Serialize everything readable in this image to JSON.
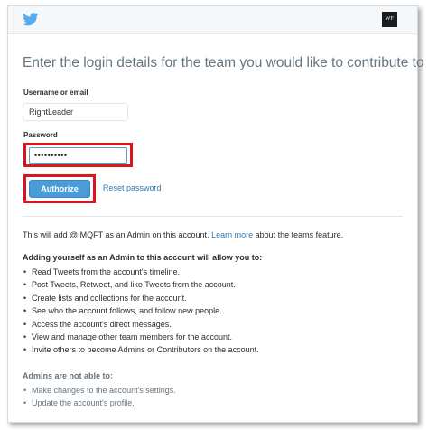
{
  "header": {
    "logo_text": "WF"
  },
  "form": {
    "title": "Enter the login details for the team you would like to contribute to",
    "username_label": "Username or email",
    "username_value": "RightLeader",
    "password_label": "Password",
    "password_value": "••••••••••",
    "authorize_label": "Authorize",
    "reset_link": "Reset password"
  },
  "info": {
    "text_before": "This will add @IMQFT as an Admin on this account. ",
    "learn_more": "Learn more",
    "text_after": " about the teams feature."
  },
  "allow": {
    "title": "Adding yourself as an Admin to this account will allow you to:",
    "items": [
      "Read Tweets from the account's timeline.",
      "Post Tweets, Retweet, and like Tweets from the account.",
      "Create lists and collections for the account.",
      "See who the account follows, and follow new people.",
      "Access the account's direct messages.",
      "View and manage other team members for the account.",
      "Invite others to become Admins or Contributors on the account."
    ]
  },
  "not_allowed": {
    "title": "Admins are not able to:",
    "items": [
      "Make changes to the account's settings.",
      "Update the account's profile."
    ]
  },
  "colors": {
    "twitter_blue": "#55acee",
    "button_blue": "#4a9cd8",
    "link_blue": "#2b7bb9",
    "highlight_red": "#d9151e"
  }
}
